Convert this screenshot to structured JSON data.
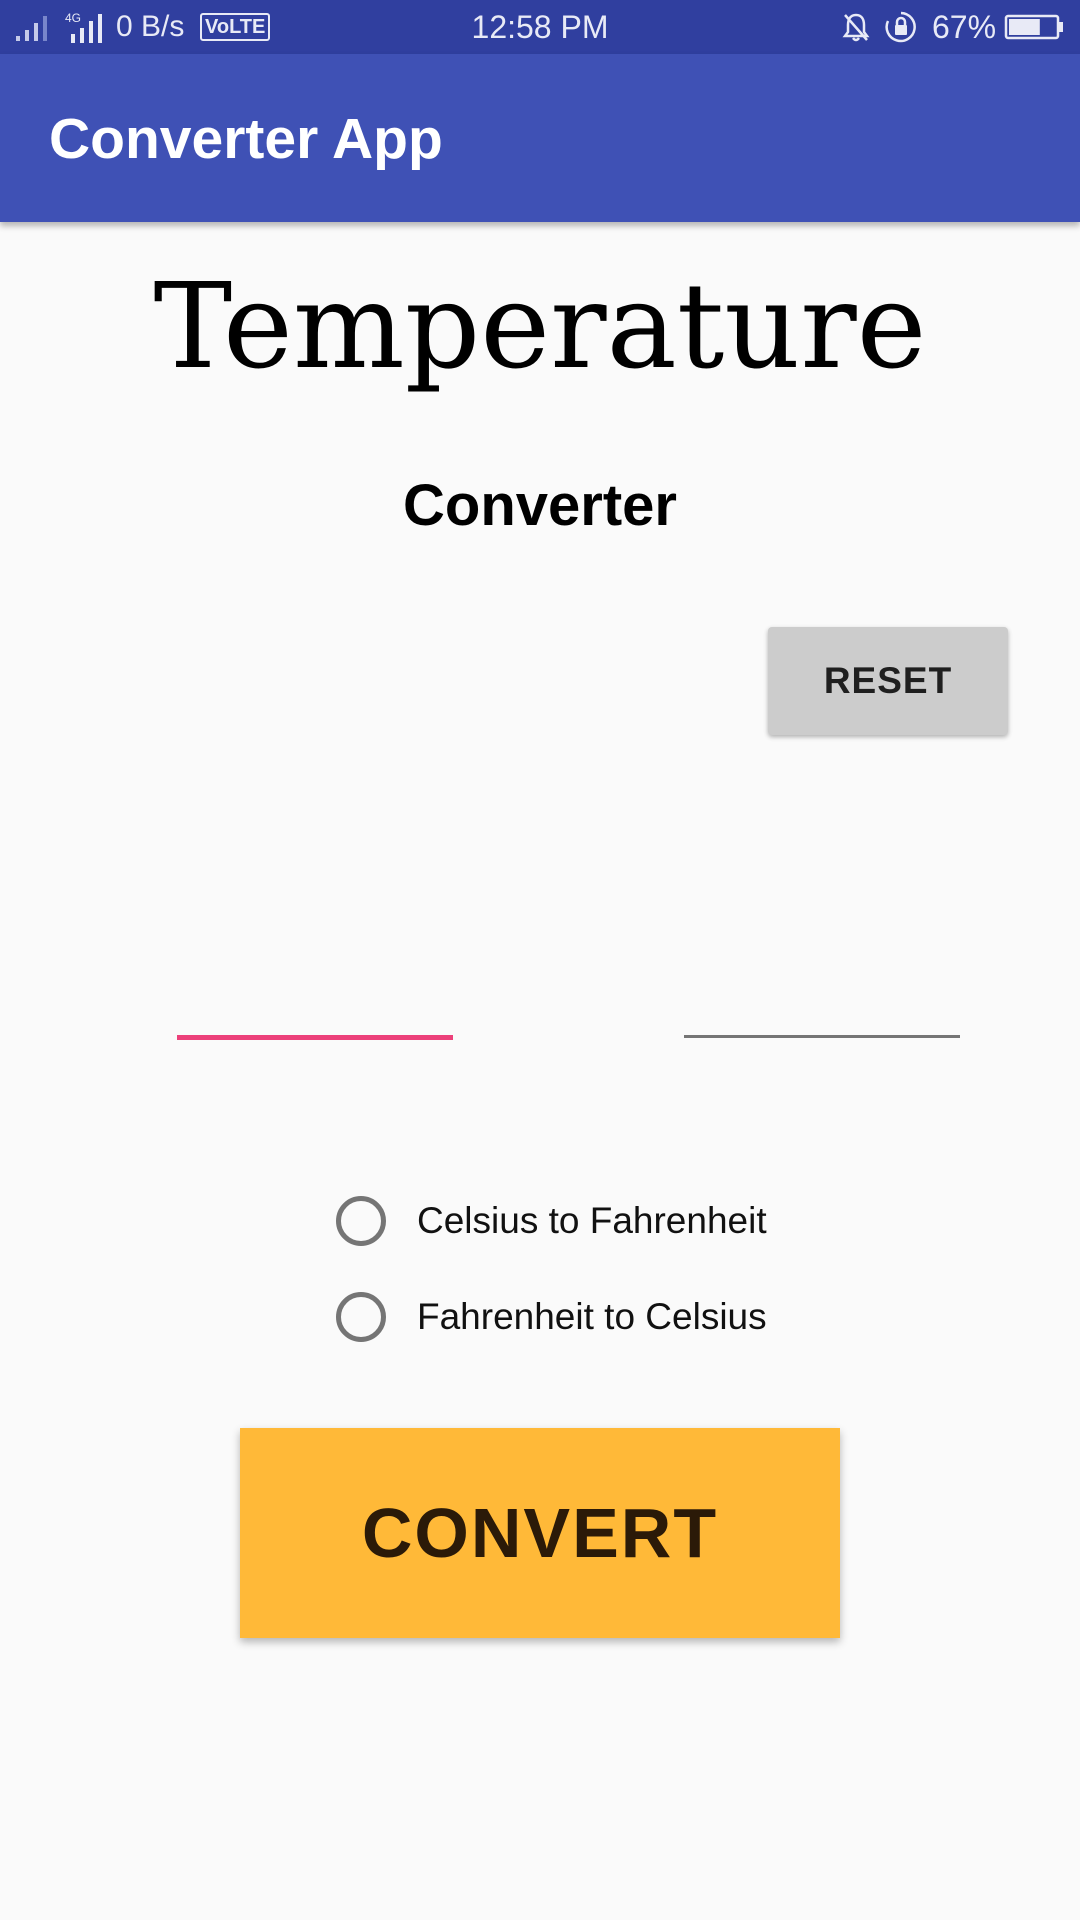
{
  "status_bar": {
    "data_rate": "0 B/s",
    "network_type": "4G",
    "volte": "VoLTE",
    "time": "12:58 PM",
    "battery_percent": "67%",
    "battery_level": 0.67,
    "icons": [
      "signal-icon",
      "4g-signal-icon",
      "volte-icon",
      "mute-bell-icon",
      "rotation-lock-icon",
      "battery-icon"
    ]
  },
  "app_bar": {
    "title": "Converter App"
  },
  "main": {
    "heading": "Temperature",
    "subheading": "Converter",
    "reset_label": "RESET",
    "input_left": {
      "value": "",
      "placeholder": ""
    },
    "input_right": {
      "value": "",
      "placeholder": ""
    },
    "radio_options": [
      {
        "label": "Celsius to Fahrenheit",
        "checked": false
      },
      {
        "label": "Fahrenheit to Celsius",
        "checked": false
      }
    ],
    "convert_label": "CONVERT"
  },
  "colors": {
    "status_bar": "#303f9f",
    "app_bar": "#3f51b5",
    "accent": "#ec407a",
    "convert_button": "#ffb938",
    "reset_button": "#cccccc",
    "background": "#fafafa"
  }
}
